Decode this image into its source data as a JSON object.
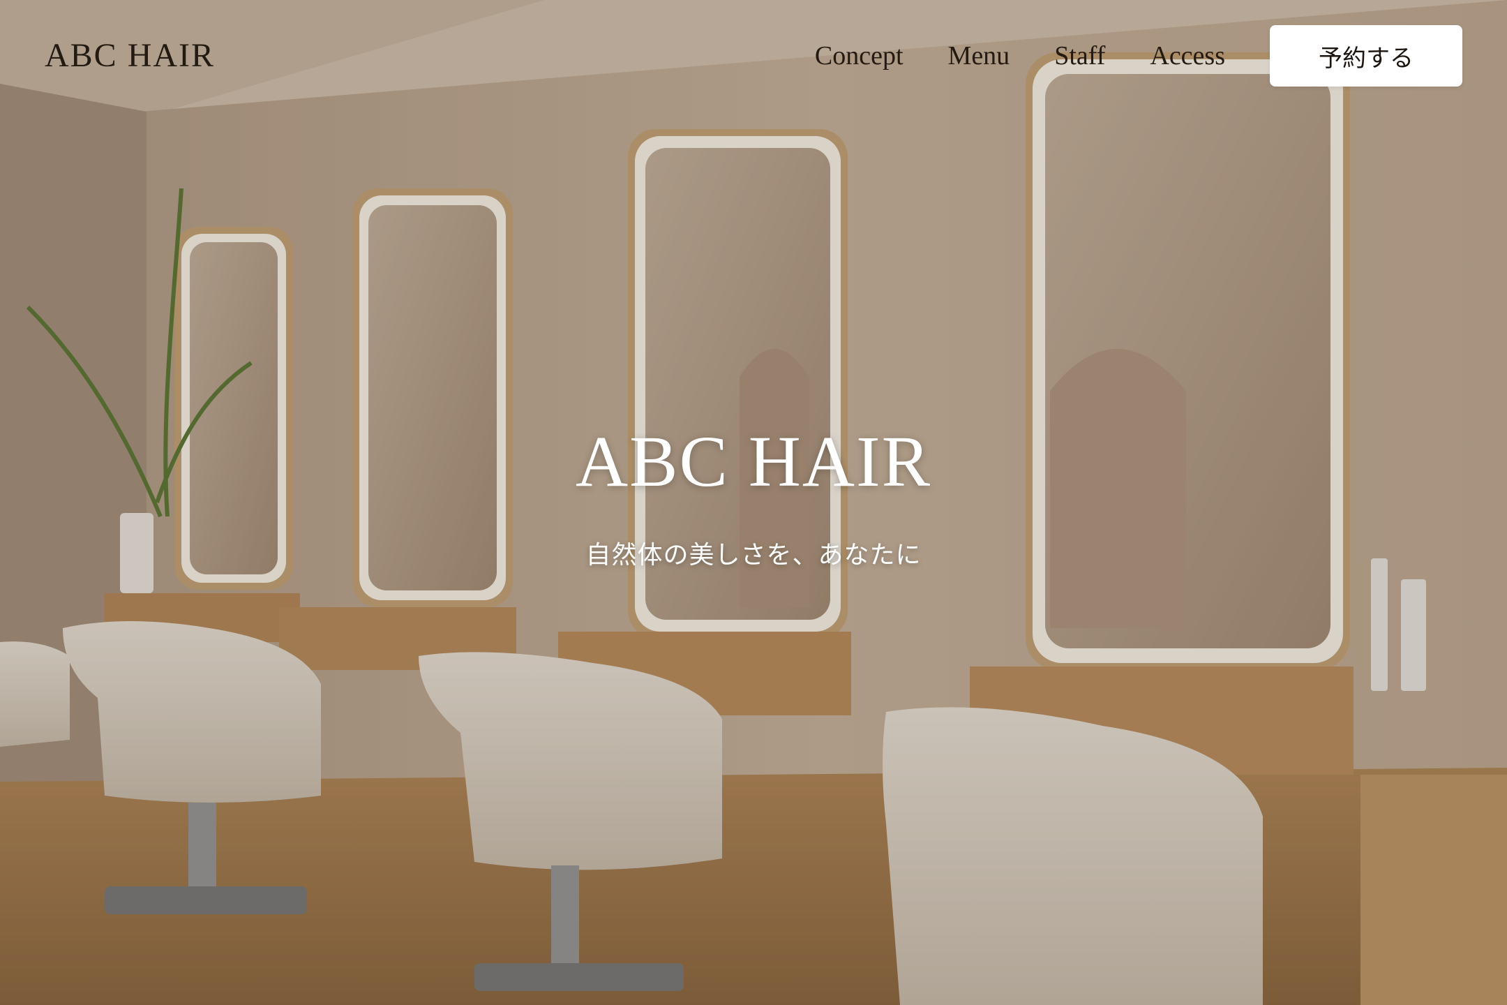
{
  "brand": {
    "logo_text": "ABC HAIR"
  },
  "nav": {
    "links": [
      "Concept",
      "Menu",
      "Staff",
      "Access"
    ],
    "reserve_label": "予約する"
  },
  "hero": {
    "title": "ABC HAIR",
    "subtitle": "自然体の美しさを、あなたに",
    "background_description_icon": "salon-interior-image"
  },
  "colors": {
    "text_dark": "#231a12",
    "button_bg": "#ffffff",
    "wall": "#cdb9a3",
    "floor": "#b98e5c"
  }
}
